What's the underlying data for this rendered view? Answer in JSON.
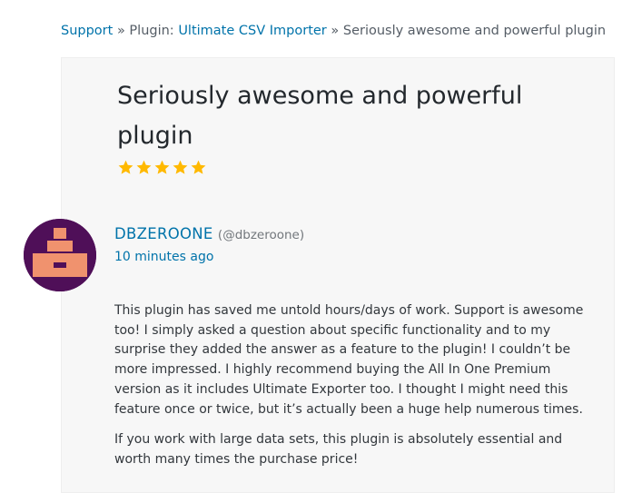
{
  "breadcrumb": {
    "support": "Support",
    "sep1": "»",
    "plugin_prefix": "Plugin:",
    "plugin_name": "Ultimate CSV Importer",
    "sep2": "»",
    "current": "Seriously awesome and powerful plugin"
  },
  "review": {
    "title": "Seriously awesome and powerful plugin",
    "rating": 5,
    "star_color": "#ffb900",
    "author_name": "DBZEROONE",
    "author_handle": "(@dbzeroone)",
    "timestamp": "10 minutes ago",
    "paragraphs": [
      "This plugin has saved me untold hours/days of work. Support is awesome too! I simply asked a question about specific functionality and to my surprise they added the answer as a feature to the plugin! I couldn’t be more impressed. I highly recommend buying the All In One Premium version as it includes Ultimate Exporter too. I thought I might need this feature once or twice, but it’s actually been a huge help numerous times.",
      "If you work with large data sets, this plugin is absolutely essential and worth many times the purchase price!"
    ]
  },
  "colors": {
    "link": "#0073aa",
    "avatar_bg": "#4f0f58",
    "avatar_fg": "#f0926e"
  }
}
